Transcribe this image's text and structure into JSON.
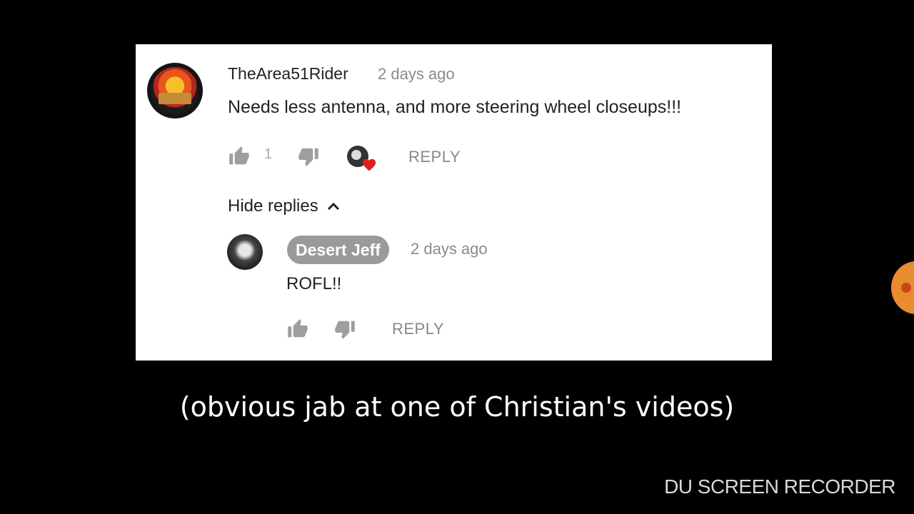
{
  "comment": {
    "author": "TheArea51Rider",
    "time": "2 days ago",
    "text": "Needs less antenna, and more steering wheel closeups!!!",
    "like_count": "1",
    "reply_label": "REPLY",
    "hide_replies_label": "Hide replies"
  },
  "reply": {
    "author": "Desert Jeff",
    "time": "2 days ago",
    "text": "ROFL!!",
    "reply_label": "REPLY"
  },
  "caption": "(obvious jab at one of Christian's videos)",
  "watermark": "DU SCREEN RECORDER",
  "icons": {
    "like": "thumbs-up-icon",
    "dislike": "thumbs-down-icon",
    "heart": "heart-icon",
    "chevron": "chevron-up-icon"
  },
  "colors": {
    "owner_badge": "#9a9a9a",
    "heart": "#e02020",
    "secondary_text": "#8a8a8a"
  }
}
